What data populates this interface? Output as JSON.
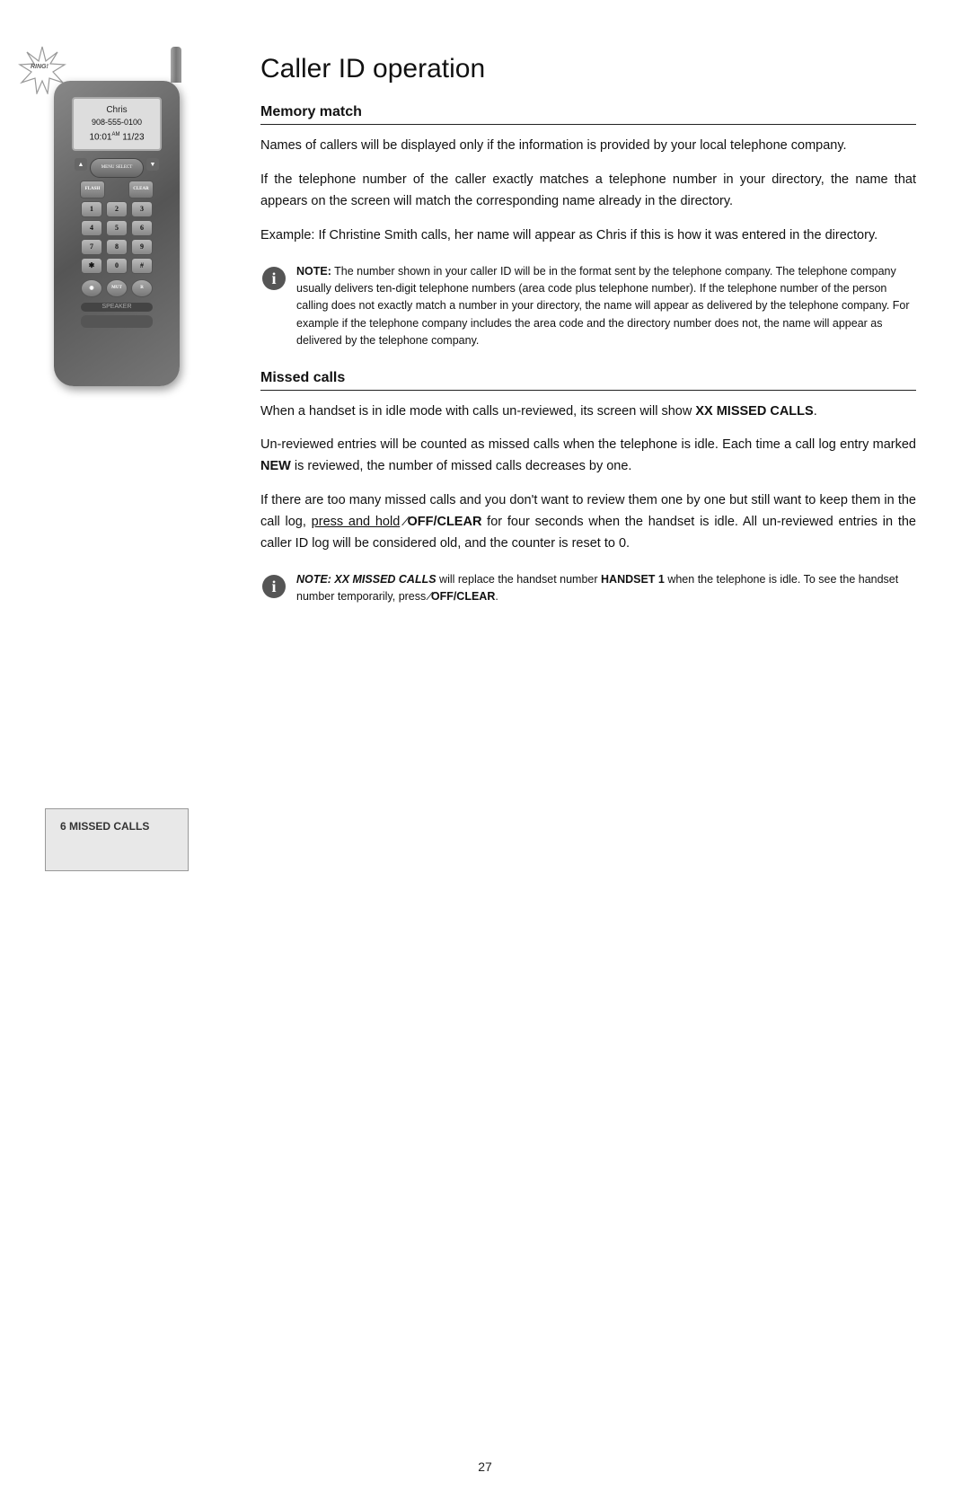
{
  "page": {
    "title": "Caller ID operation",
    "page_number": "27"
  },
  "sections": {
    "memory_match": {
      "heading": "Memory match",
      "paragraph1": "Names of callers will be displayed only if the information is provided by your local telephone company.",
      "paragraph2": "If the telephone number of the caller exactly matches a telephone number in your directory, the name that appears on the screen will match the corresponding name already in the directory.",
      "paragraph3": "Example: If Christine Smith calls, her name will appear as Chris if this is how it was entered in the directory.",
      "note1": "NOTE: The number shown in your caller ID will be in the format sent by the telephone company. The telephone company usually delivers ten-digit telephone numbers (area code plus telephone number). If the telephone number of the person calling does not exactly match a number in your directory, the name will appear as delivered by the telephone company. For example if the telephone company includes the area code and the directory number does not, the name will appear as delivered by the telephone company."
    },
    "missed_calls": {
      "heading": "Missed calls",
      "paragraph1": "When a handset is in idle mode with calls un-reviewed, its screen will show XX MISSED CALLS.",
      "paragraph2": "Un-reviewed entries will be counted as missed calls when the telephone is idle. Each time a call log entry marked NEW is reviewed, the number of missed calls decreases by one.",
      "paragraph3_before": "If there are too many missed calls and you don’t want to review them one by one but still want to keep them in the call log,",
      "paragraph3_underline": "press and hold",
      "paragraph3_after": "⁠OFF/CLEAR for four seconds when the handset is idle. All un-reviewed entries in the caller ID log will be considered old, and the counter is reset to 0.",
      "note2_line1": "NOTE: XX MISSED CALLS will replace the handset number",
      "note2_line2": "HANDSET 1 when the telephone is idle. To see the handset",
      "note2_line3": "number temporarily, press ⁠OFF/CLEAR."
    }
  },
  "phone_display": {
    "caller_name": "Chris",
    "caller_number": "908-555-0100",
    "caller_time": "10:01",
    "caller_am": "AM",
    "caller_date": "11/23"
  },
  "missed_calls_display": {
    "text": "6 MISSED CALLS"
  },
  "ring_label": "RING!"
}
